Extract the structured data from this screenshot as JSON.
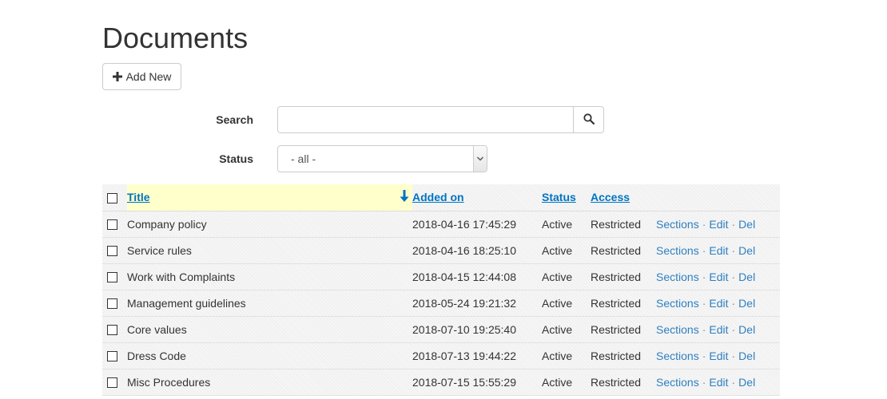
{
  "page": {
    "title": "Documents"
  },
  "toolbar": {
    "add_label": "Add New",
    "add_icon": "plus-icon"
  },
  "filters": {
    "search_label": "Search",
    "search_value": "",
    "search_icon": "search-icon",
    "status_label": "Status",
    "status_selected": "- all -"
  },
  "table": {
    "columns": {
      "title": "Title",
      "added_on": "Added on",
      "status": "Status",
      "access": "Access"
    },
    "sort": {
      "column": "title",
      "direction": "descending",
      "icon": "arrow-down-icon"
    },
    "actions": {
      "sections": "Sections",
      "edit": "Edit",
      "del": "Del",
      "separator": "·"
    },
    "rows": [
      {
        "title": "Company policy",
        "added_on": "2018-04-16 17:45:29",
        "status": "Active",
        "access": "Restricted"
      },
      {
        "title": "Service rules",
        "added_on": "2018-04-16 18:25:10",
        "status": "Active",
        "access": "Restricted"
      },
      {
        "title": "Work with Complaints",
        "added_on": "2018-04-15 12:44:08",
        "status": "Active",
        "access": "Restricted"
      },
      {
        "title": "Management guidelines",
        "added_on": "2018-05-24 19:21:32",
        "status": "Active",
        "access": "Restricted"
      },
      {
        "title": "Core values",
        "added_on": "2018-07-10 19:25:40",
        "status": "Active",
        "access": "Restricted"
      },
      {
        "title": "Dress Code",
        "added_on": "2018-07-13 19:44:22",
        "status": "Active",
        "access": "Restricted"
      },
      {
        "title": "Misc Procedures",
        "added_on": "2018-07-15 15:55:29",
        "status": "Active",
        "access": "Restricted"
      }
    ]
  },
  "colors": {
    "link": "#0074c2",
    "action_link": "#2f80c0",
    "sorted_header_bg": "#ffffcc"
  }
}
